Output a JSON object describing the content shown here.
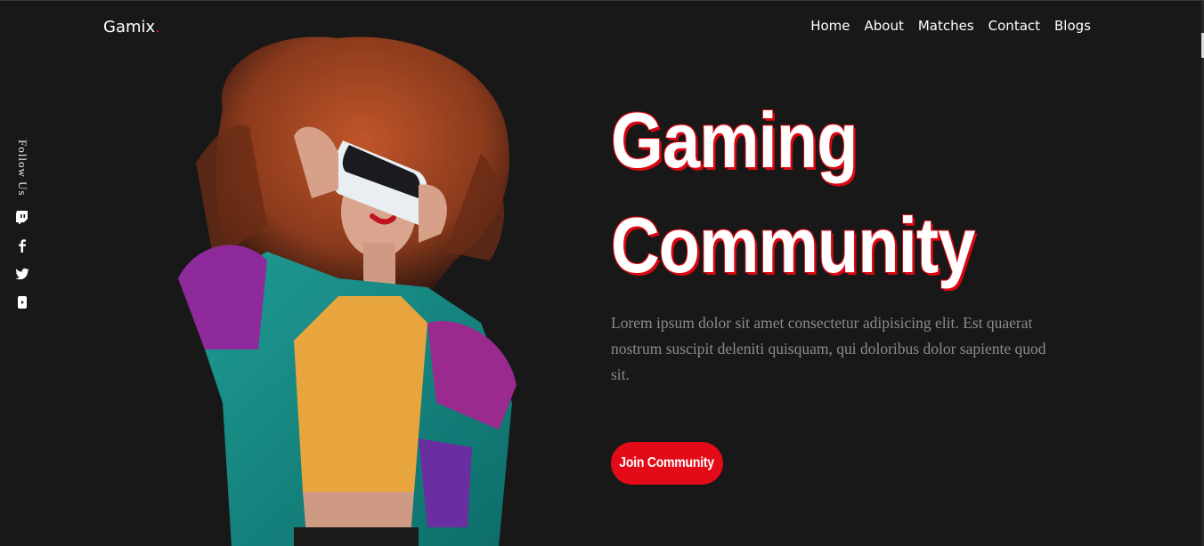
{
  "brand": {
    "name": "Gamix",
    "dot": "."
  },
  "nav": {
    "items": [
      "Home",
      "About",
      "Matches",
      "Contact",
      "Blogs"
    ]
  },
  "follow": {
    "label": "Follow Us",
    "icons": [
      "twitch-icon",
      "facebook-icon",
      "twitter-icon",
      "youtube-icon"
    ]
  },
  "hero": {
    "title_line1": "Gaming",
    "title_line2": "Community",
    "description": "Lorem ipsum dolor sit amet consectetur adipisicing elit. Est quaerat nostrum suscipit deleniti quisquam, qui doloribus dolor sapiente quod sit.",
    "cta_label": "Join Community",
    "image": "woman-wearing-vr-headset"
  },
  "colors": {
    "background": "#181818",
    "accent": "#e30b17",
    "text": "#ffffff",
    "muted": "#8b8b8b"
  }
}
